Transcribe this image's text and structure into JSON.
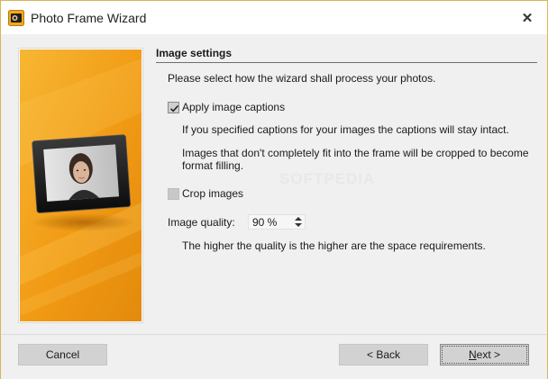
{
  "window": {
    "title": "Photo Frame Wizard",
    "close_glyph": "✕"
  },
  "panel": {
    "section_title": "Image settings",
    "intro": "Please select how the wizard shall process your photos.",
    "apply_captions": {
      "label": "Apply image captions",
      "checked": true,
      "note": "If you specified captions for your images the captions will stay intact."
    },
    "crop_note_line1": "Images that don't completely fit into the frame will be cropped to become",
    "crop_note_line2": "format filling.",
    "crop_images": {
      "label": "Crop images",
      "checked": false
    },
    "image_quality": {
      "label": "Image quality:",
      "value": "90 %",
      "note": "The higher the quality is the higher are the space requirements."
    }
  },
  "watermark": "SOFTPEDIA",
  "footer": {
    "cancel_label": "Cancel",
    "back_label": "< Back",
    "next_label": "Next >",
    "next_mnemonic": "N",
    "next_rest": "ext >"
  },
  "colors": {
    "accent_orange": "#f5a623",
    "window_border": "#d6b656",
    "button_bg": "#d2d2d2"
  },
  "icons": {
    "app": "photo-frame-app-icon",
    "close": "close-icon",
    "check": "checkmark-icon",
    "spin": "spin-arrows-icon"
  }
}
